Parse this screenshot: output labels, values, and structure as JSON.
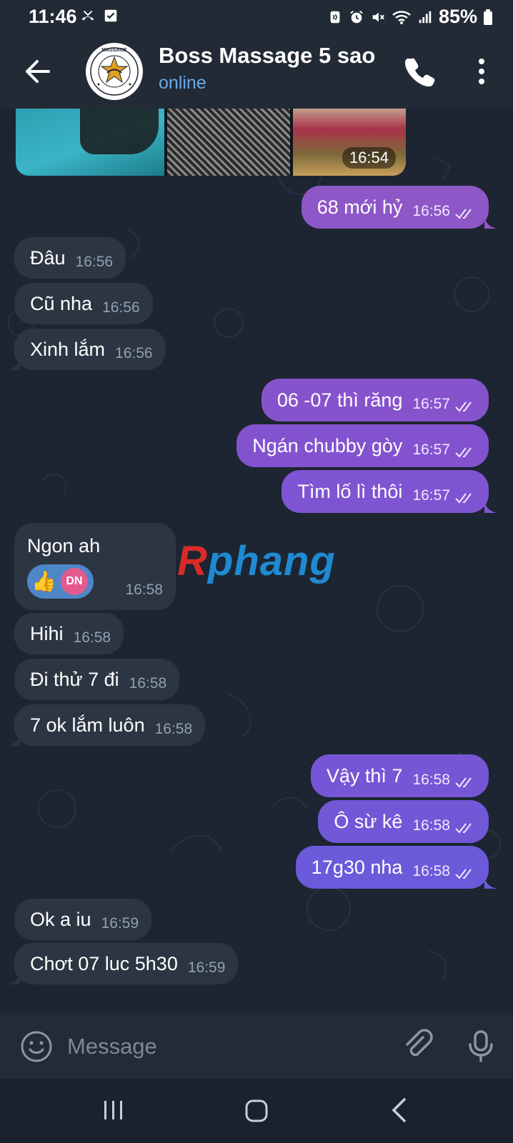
{
  "status_bar": {
    "time": "11:46",
    "battery": "85%",
    "left_icons": [
      "missed-call-icon",
      "checkbox-notification-icon"
    ],
    "right_icons": [
      "nfc-icon",
      "alarm-icon",
      "mute-icon",
      "wifi-icon",
      "signal-icon",
      "battery-icon"
    ]
  },
  "header": {
    "title": "Boss Massage 5 sao",
    "status": "online",
    "avatar_text": "MASSAGE"
  },
  "media": {
    "time": "16:54"
  },
  "messages": [
    {
      "dir": "out",
      "text": "68 mới hỷ",
      "time": "16:56"
    },
    {
      "dir": "in",
      "text": "Đâu",
      "time": "16:56"
    },
    {
      "dir": "in",
      "text": "Cũ nha",
      "time": "16:56"
    },
    {
      "dir": "in",
      "text": "Xinh lắm",
      "time": "16:56"
    },
    {
      "dir": "out",
      "text": "06 -07 thì răng",
      "time": "16:57"
    },
    {
      "dir": "out",
      "text": "Ngán chubby gòy",
      "time": "16:57"
    },
    {
      "dir": "out",
      "text": "Tìm lố lì thôi",
      "time": "16:57"
    },
    {
      "dir": "in",
      "text": "Ngon ah",
      "time": "16:58",
      "reaction": "👍",
      "reaction_avatar": "DN"
    },
    {
      "dir": "in",
      "text": "Hihi",
      "time": "16:58"
    },
    {
      "dir": "in",
      "text": "Đi thử 7 đi",
      "time": "16:58"
    },
    {
      "dir": "in",
      "text": "7 ok lắm luôn",
      "time": "16:58"
    },
    {
      "dir": "out",
      "text": "Vậy thì 7",
      "time": "16:58"
    },
    {
      "dir": "out",
      "text": "Ô sừ kê",
      "time": "16:58"
    },
    {
      "dir": "out",
      "text": "17g30 nha",
      "time": "16:58"
    },
    {
      "dir": "in",
      "text": "Ok a iu",
      "time": "16:59"
    },
    {
      "dir": "in",
      "text": "Chơt 07 luc 5h30",
      "time": "16:59"
    }
  ],
  "watermark": {
    "first": "R",
    "rest": "phang"
  },
  "input": {
    "placeholder": "Message"
  },
  "colors": {
    "out_bubble_start": "#9a55c4",
    "out_bubble_end": "#6a5bdc",
    "in_bubble": "#2c3542",
    "link_blue": "#6aa9e9"
  }
}
